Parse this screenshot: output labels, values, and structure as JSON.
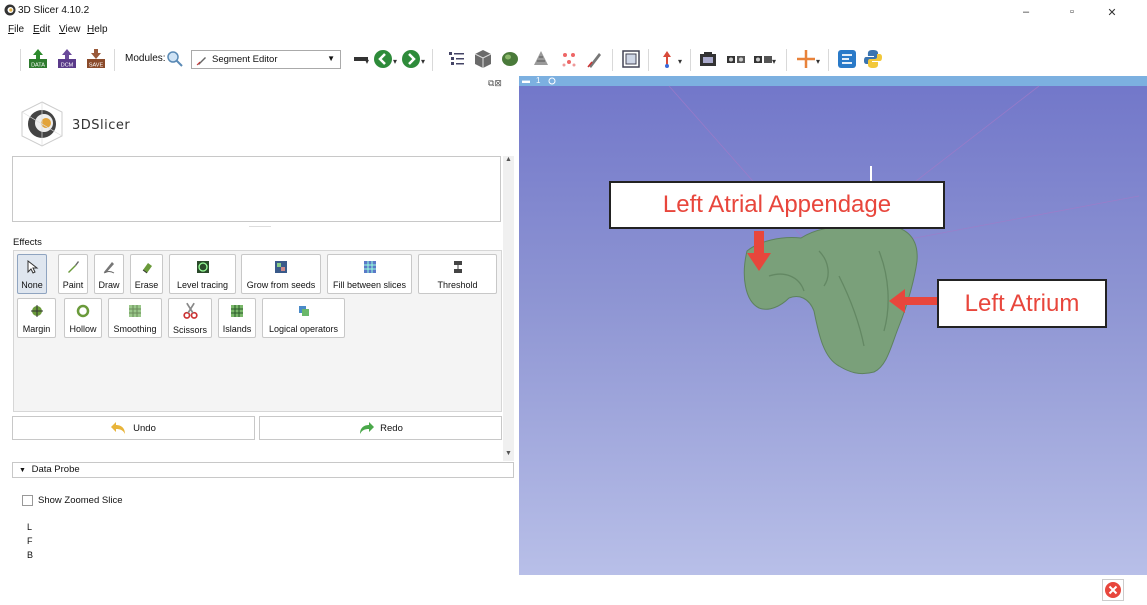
{
  "window": {
    "title": "3D Slicer 4.10.2",
    "minimize": "–",
    "restore": "▫",
    "close": "✕"
  },
  "menu": [
    {
      "label": "File",
      "mnemonic": "F",
      "rest": "ile"
    },
    {
      "label": "Edit",
      "mnemonic": "E",
      "rest": "dit"
    },
    {
      "label": "View",
      "mnemonic": "V",
      "rest": "iew"
    },
    {
      "label": "Help",
      "mnemonic": "H",
      "rest": "elp"
    }
  ],
  "toolbar": {
    "data_label": "DATA",
    "dcm_label": "DCM",
    "save_label": "SAVE",
    "modules_label": "Modules:",
    "module_selected": "Segment Editor"
  },
  "panel": {
    "logo_text": "3DSlicer",
    "effects_label": "Effects",
    "effects_row1": [
      "None",
      "Paint",
      "Draw",
      "Erase",
      "Level tracing",
      "Grow from seeds",
      "Fill between slices",
      "Threshold"
    ],
    "effects_row2": [
      "Margin",
      "Hollow",
      "Smoothing",
      "Scissors",
      "Islands",
      "Logical operators"
    ],
    "undo_label": "Undo",
    "redo_label": "Redo",
    "data_probe_label": "Data Probe",
    "show_zoomed_slice_label": "Show Zoomed Slice",
    "coords": [
      "L",
      "F",
      "B"
    ]
  },
  "view": {
    "view_number": "1"
  },
  "annotations": {
    "appendage_label": "Left Atrial Appendage",
    "atrium_label": "Left Atrium"
  },
  "colors": {
    "segment_green": "#7aa07a",
    "annotation_red": "#e8463c",
    "view_top": "#7176c9",
    "view_bottom": "#b8bfe8"
  }
}
